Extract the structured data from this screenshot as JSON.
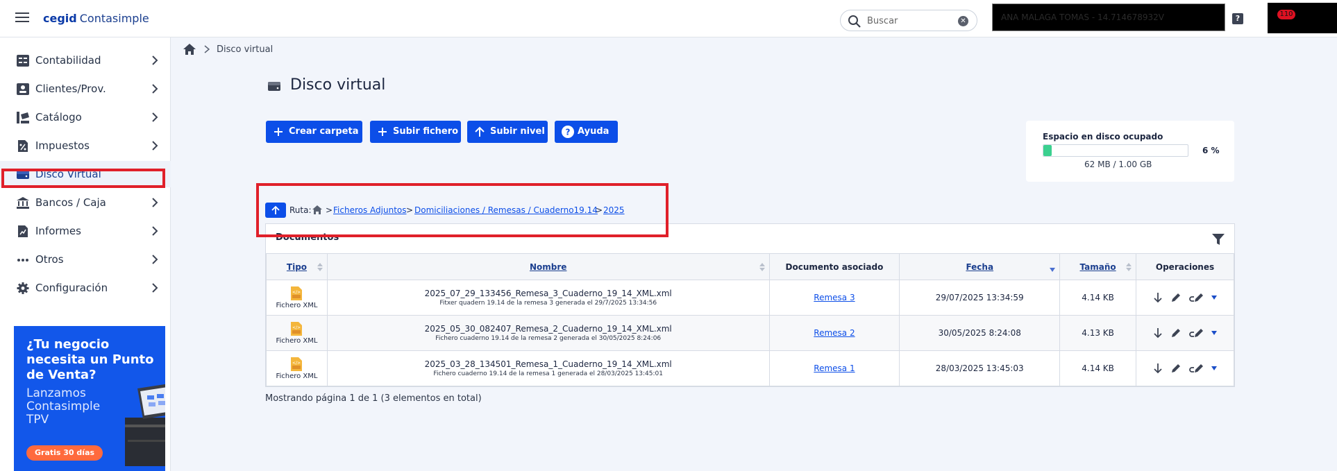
{
  "app": {
    "logo_brand": "cegid",
    "logo_product": "Contasimple"
  },
  "search": {
    "placeholder": "Buscar",
    "value": ""
  },
  "user": {
    "name": "ANA MALAGA TOMAS - 14.714678932V",
    "badge": "110"
  },
  "sidebar": {
    "items": [
      {
        "label": "Contabilidad",
        "icon": "ledger-icon"
      },
      {
        "label": "Clientes/Prov.",
        "icon": "contact-card-icon"
      },
      {
        "label": "Catálogo",
        "icon": "catalog-icon"
      },
      {
        "label": "Impuestos",
        "icon": "tax-document-icon"
      },
      {
        "label": "Disco Virtual",
        "icon": "drive-icon",
        "active": true
      },
      {
        "label": "Bancos / Caja",
        "icon": "bank-icon"
      },
      {
        "label": "Informes",
        "icon": "report-icon"
      },
      {
        "label": "Otros",
        "icon": "more-icon"
      },
      {
        "label": "Configuración",
        "icon": "gear-icon"
      }
    ],
    "promo": {
      "headline": "¿Tu negocio necesita un Punto de Venta?",
      "text": "Lanzamos Contasimple TPV",
      "cta": "Gratis 30 días"
    }
  },
  "breadcrumb": {
    "current": "Disco virtual"
  },
  "page": {
    "title": "Disco virtual"
  },
  "toolbar": {
    "create_folder": "Crear carpeta",
    "upload_file": "Subir fichero",
    "up_level": "Subir nivel",
    "help": "Ayuda"
  },
  "disk": {
    "title": "Espacio en disco ocupado",
    "percent": 6,
    "percent_label": "6 %",
    "used_label": "62 MB / 1.00 GB"
  },
  "path": {
    "label": "Ruta:",
    "segments": [
      "Ficheros Adjuntos",
      "Domiciliaciones / Remesas / Cuaderno19.14",
      "2025"
    ],
    "sep_home": ">",
    "sep": ">"
  },
  "documents": {
    "header": "Documentos",
    "columns": [
      "Tipo",
      "Nombre",
      "Documento asociado",
      "Fecha",
      "Tamaño",
      "Operaciones"
    ],
    "rows": [
      {
        "type": "Fichero XML",
        "name": "2025_07_29_133456_Remesa_3_Cuaderno_19_14_XML.xml",
        "desc": "Fitxer quadern 19.14 de la remesa 3 generada el 29/7/2025 13:34:56",
        "assoc": "Remesa 3",
        "date": "29/07/2025 13:34:59",
        "size": "4.14 KB"
      },
      {
        "type": "Fichero XML",
        "name": "2025_05_30_082407_Remesa_2_Cuaderno_19_14_XML.xml",
        "desc": "Fichero cuaderno 19.14 de la remesa 2 generada el 30/05/2025 8:24:06",
        "assoc": "Remesa 2",
        "date": "30/05/2025 8:24:08",
        "size": "4.13 KB"
      },
      {
        "type": "Fichero XML",
        "name": "2025_03_28_134501_Remesa_1_Cuaderno_19_14_XML.xml",
        "desc": "Fichero cuaderno 19.14 de la remesa 1 generada el 28/03/2025 13:45:01",
        "assoc": "Remesa 1",
        "date": "28/03/2025 13:45:03",
        "size": "4.14 KB"
      }
    ],
    "paging": "Mostrando página 1 de 1 (3 elementos en total)"
  },
  "colors": {
    "primary": "#0c4ee8",
    "highlight": "#e0202a",
    "disk_fill": "#3bd08f"
  }
}
